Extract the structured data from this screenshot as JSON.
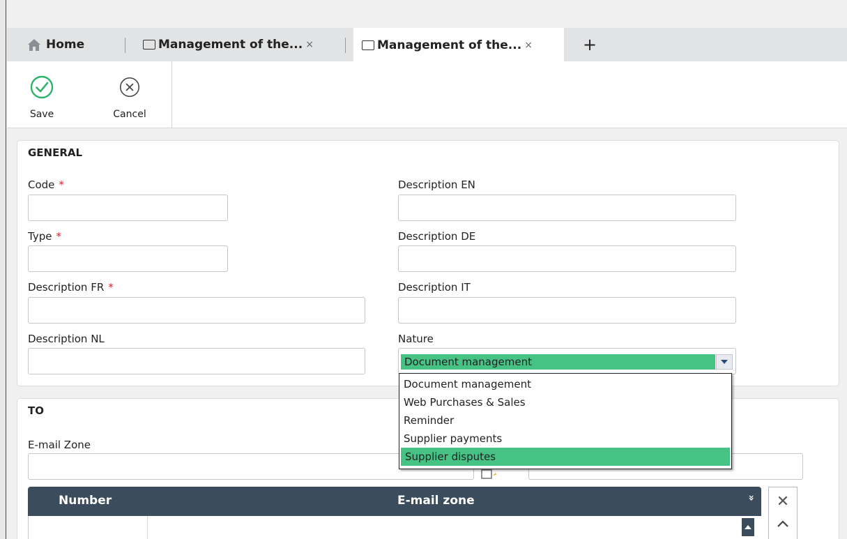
{
  "tabs": {
    "home_label": "Home",
    "tab1_label": "Management of the...",
    "tab2_label": "Management of the...",
    "close_glyph": "×",
    "add_glyph": "+"
  },
  "toolbar": {
    "save_label": "Save",
    "cancel_label": "Cancel"
  },
  "general": {
    "title": "GENERAL",
    "code_label": "Code",
    "type_label": "Type",
    "description_fr_label": "Description FR",
    "description_nl_label": "Description NL",
    "description_en_label": "Description EN",
    "description_de_label": "Description DE",
    "description_it_label": "Description IT",
    "nature_label": "Nature",
    "required_mark": "*",
    "nature_value": "Document management",
    "nature_options": [
      "Document management",
      "Web Purchases & Sales",
      "Reminder",
      "Supplier payments",
      "Supplier disputes"
    ],
    "highlighted_option": "Supplier disputes"
  },
  "to_section": {
    "title": "TO",
    "email_zone_label": "E-mail Zone",
    "grid_headers": [
      "Number",
      "E-mail zone"
    ],
    "sort_glyph": "»"
  },
  "colors": {
    "accent_green": "#46c285",
    "grid_header": "#3b4d5c",
    "required_red": "#d9232d",
    "save_green": "#2fb36b"
  },
  "icons": [
    "home-icon",
    "document-icon",
    "close-icon",
    "plus-icon",
    "check-circle-icon",
    "x-circle-icon",
    "chevron-down-icon",
    "picker-icon",
    "double-chevron-icon",
    "scroll-up-icon",
    "chevron-up-icon"
  ]
}
